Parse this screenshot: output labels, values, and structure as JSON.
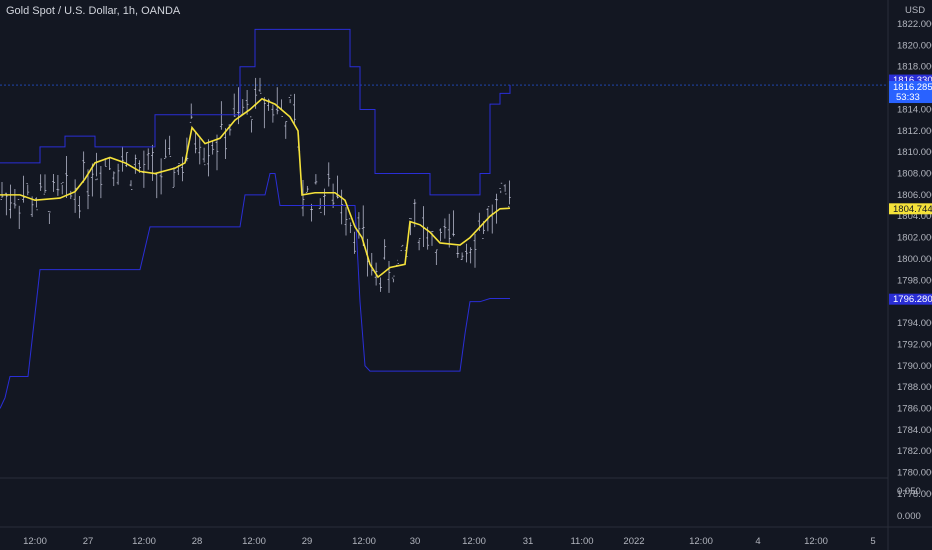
{
  "chart": {
    "title": "Gold Spot / U.S. Dollar, 1h, OANDA",
    "currency": "USD",
    "colors": {
      "background": "#131722",
      "donchian": "#2a2ed6",
      "ma": "#f5e23a",
      "candle": "#c9cce0",
      "price_tag": "#2962ff"
    },
    "price_ticks": [
      "1822.000",
      "1820.000",
      "1818.000",
      "1816.000",
      "1814.000",
      "1812.000",
      "1810.000",
      "1808.000",
      "1806.000",
      "1804.000",
      "1802.000",
      "1800.000",
      "1798.000",
      "1796.000",
      "1794.000",
      "1792.000",
      "1790.000",
      "1788.000",
      "1786.000",
      "1784.000",
      "1782.000",
      "1780.000",
      "1778.000"
    ],
    "time_ticks": [
      "12:00",
      "27",
      "12:00",
      "28",
      "12:00",
      "29",
      "12:00",
      "30",
      "12:00",
      "31",
      "11:00",
      "2022",
      "12:00",
      "4",
      "12:00",
      "5"
    ],
    "sub_ticks": [
      "0.050",
      "0.000"
    ],
    "tags": {
      "upper": "1816.330",
      "last": "1816.285",
      "countdown": "53:33",
      "ma": "1804.744",
      "lower": "1796.280"
    },
    "chart_data": {
      "type": "line",
      "ylim": [
        1777,
        1823
      ],
      "series": [
        {
          "kind": "donchian-upper",
          "points": [
            [
              0,
              1809
            ],
            [
              40,
              1809
            ],
            [
              40,
              1810.5
            ],
            [
              65,
              1810.5
            ],
            [
              65,
              1811.5
            ],
            [
              95,
              1811.5
            ],
            [
              95,
              1810.5
            ],
            [
              155,
              1810.5
            ],
            [
              155,
              1813.5
            ],
            [
              240,
              1813.5
            ],
            [
              240,
              1818
            ],
            [
              255,
              1818
            ],
            [
              255,
              1821.5
            ],
            [
              350,
              1821.5
            ],
            [
              350,
              1818
            ],
            [
              360,
              1818
            ],
            [
              360,
              1814
            ],
            [
              375,
              1814
            ],
            [
              375,
              1808
            ],
            [
              430,
              1808
            ],
            [
              430,
              1806
            ],
            [
              480,
              1806
            ],
            [
              480,
              1808
            ],
            [
              490,
              1808
            ],
            [
              490,
              1814.5
            ],
            [
              500,
              1814.5
            ],
            [
              500,
              1815.5
            ],
            [
              510,
              1815.5
            ],
            [
              510,
              1816.3
            ]
          ]
        },
        {
          "kind": "donchian-lower",
          "points": [
            [
              0,
              1786
            ],
            [
              5,
              1787
            ],
            [
              10,
              1789
            ],
            [
              28,
              1789
            ],
            [
              40,
              1799
            ],
            [
              45,
              1799
            ],
            [
              45,
              1799
            ],
            [
              140,
              1799
            ],
            [
              150,
              1803
            ],
            [
              240,
              1803
            ],
            [
              245,
              1806
            ],
            [
              265,
              1806
            ],
            [
              270,
              1808
            ],
            [
              275,
              1808
            ],
            [
              280,
              1805
            ],
            [
              290,
              1805
            ],
            [
              355,
              1805
            ],
            [
              360,
              1796
            ],
            [
              365,
              1790
            ],
            [
              370,
              1789.5
            ],
            [
              460,
              1789.5
            ],
            [
              465,
              1793
            ],
            [
              470,
              1796
            ],
            [
              480,
              1796
            ],
            [
              490,
              1796.3
            ],
            [
              510,
              1796.3
            ]
          ]
        },
        {
          "kind": "moving-average",
          "points": [
            [
              0,
              1806
            ],
            [
              20,
              1806
            ],
            [
              35,
              1805.5
            ],
            [
              60,
              1805.7
            ],
            [
              75,
              1806.3
            ],
            [
              85,
              1807.5
            ],
            [
              95,
              1809
            ],
            [
              110,
              1809.5
            ],
            [
              125,
              1809
            ],
            [
              140,
              1808.2
            ],
            [
              155,
              1808
            ],
            [
              175,
              1808.5
            ],
            [
              185,
              1809
            ],
            [
              192,
              1812.3
            ],
            [
              205,
              1810.8
            ],
            [
              220,
              1811.3
            ],
            [
              235,
              1813
            ],
            [
              250,
              1814
            ],
            [
              262,
              1815
            ],
            [
              275,
              1814.5
            ],
            [
              290,
              1813.3
            ],
            [
              298,
              1812
            ],
            [
              302,
              1806
            ],
            [
              315,
              1806.2
            ],
            [
              335,
              1806.2
            ],
            [
              345,
              1805.5
            ],
            [
              355,
              1803
            ],
            [
              362,
              1802
            ],
            [
              370,
              1799.5
            ],
            [
              378,
              1798.3
            ],
            [
              390,
              1799.2
            ],
            [
              405,
              1799.5
            ],
            [
              410,
              1803.5
            ],
            [
              420,
              1803.2
            ],
            [
              430,
              1802.5
            ],
            [
              440,
              1801.5
            ],
            [
              460,
              1801.3
            ],
            [
              470,
              1802
            ],
            [
              480,
              1803
            ],
            [
              490,
              1804
            ],
            [
              500,
              1804.7
            ],
            [
              510,
              1804.75
            ]
          ]
        }
      ]
    }
  }
}
